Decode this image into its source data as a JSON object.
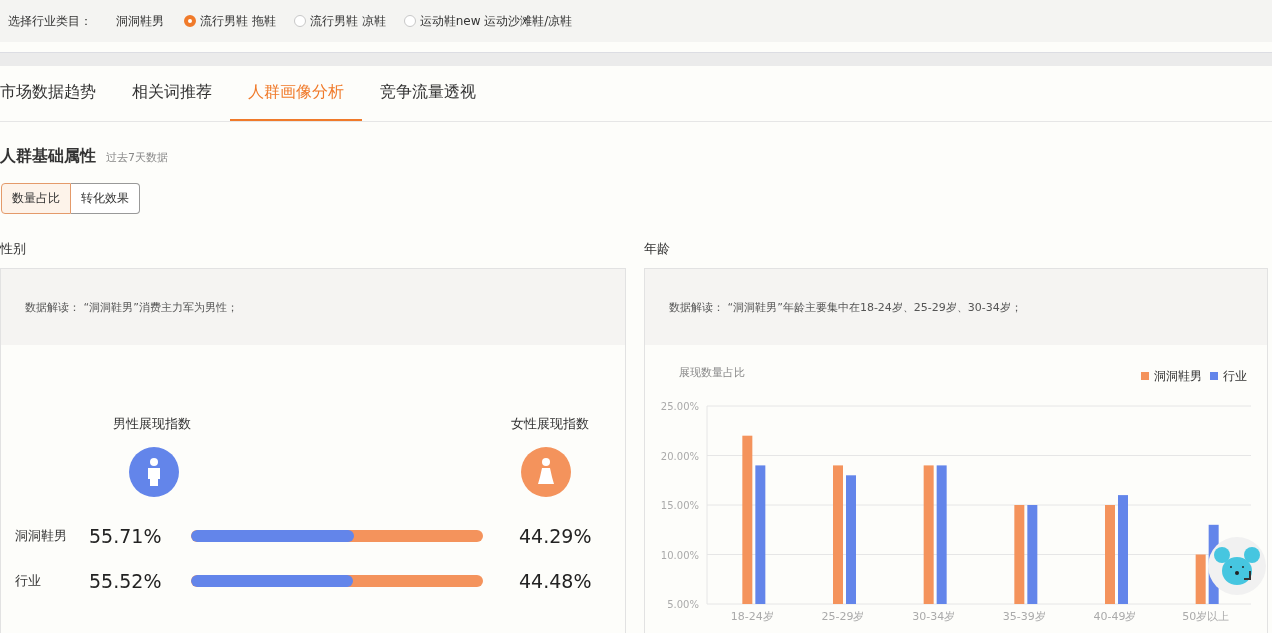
{
  "filter": {
    "label": "选择行业类目：",
    "category": "洞洞鞋男",
    "options": [
      {
        "label": "流行男鞋 拖鞋",
        "selected": true
      },
      {
        "label": "流行男鞋 凉鞋",
        "selected": false
      },
      {
        "label": "运动鞋new 运动沙滩鞋/凉鞋",
        "selected": false
      }
    ]
  },
  "tabs": [
    {
      "label": "市场数据趋势",
      "selected": false
    },
    {
      "label": "相关词推荐",
      "selected": false
    },
    {
      "label": "人群画像分析",
      "selected": true
    },
    {
      "label": "竞争流量透视",
      "selected": false
    }
  ],
  "section": {
    "title": "人群基础属性",
    "subtitle": "过去7天数据"
  },
  "segments": [
    {
      "label": "数量占比",
      "selected": true
    },
    {
      "label": "转化效果",
      "selected": false
    }
  ],
  "gender": {
    "title": "性别",
    "note": "数据解读：  “洞洞鞋男”消费主力军为男性；",
    "male_label": "男性展现指数",
    "female_label": "女性展现指数",
    "rows": [
      {
        "name": "洞洞鞋男",
        "male": "55.71%",
        "female": "44.29%",
        "level": 0.5571
      },
      {
        "name": "行业",
        "male": "55.52%",
        "female": "44.48%",
        "level": 0.5552
      }
    ]
  },
  "age": {
    "title": "年龄",
    "note": "数据解读：  “洞洞鞋男”年龄主要集中在18-24岁、25-29岁、30-34岁；",
    "chart_data": {
      "type": "bar",
      "title": "展现数量占比",
      "categories": [
        "18-24岁",
        "25-29岁",
        "30-34岁",
        "35-39岁",
        "40-49岁",
        "50岁以上"
      ],
      "series": [
        {
          "name": "洞洞鞋男",
          "color": "#f4935c",
          "values": [
            22,
            19,
            19,
            15,
            15,
            10
          ]
        },
        {
          "name": "行业",
          "color": "#6385ea",
          "values": [
            19,
            18,
            19,
            15,
            16,
            13
          ]
        }
      ],
      "ylim": [
        5,
        25
      ],
      "grid": true,
      "yticks": [
        {
          "value": 5,
          "label": "5.00%"
        },
        {
          "value": 10,
          "label": "10.00%"
        },
        {
          "value": 15,
          "label": "15.00%"
        },
        {
          "value": 20,
          "label": "20.00%"
        },
        {
          "value": 25,
          "label": "25.00%"
        }
      ]
    }
  }
}
